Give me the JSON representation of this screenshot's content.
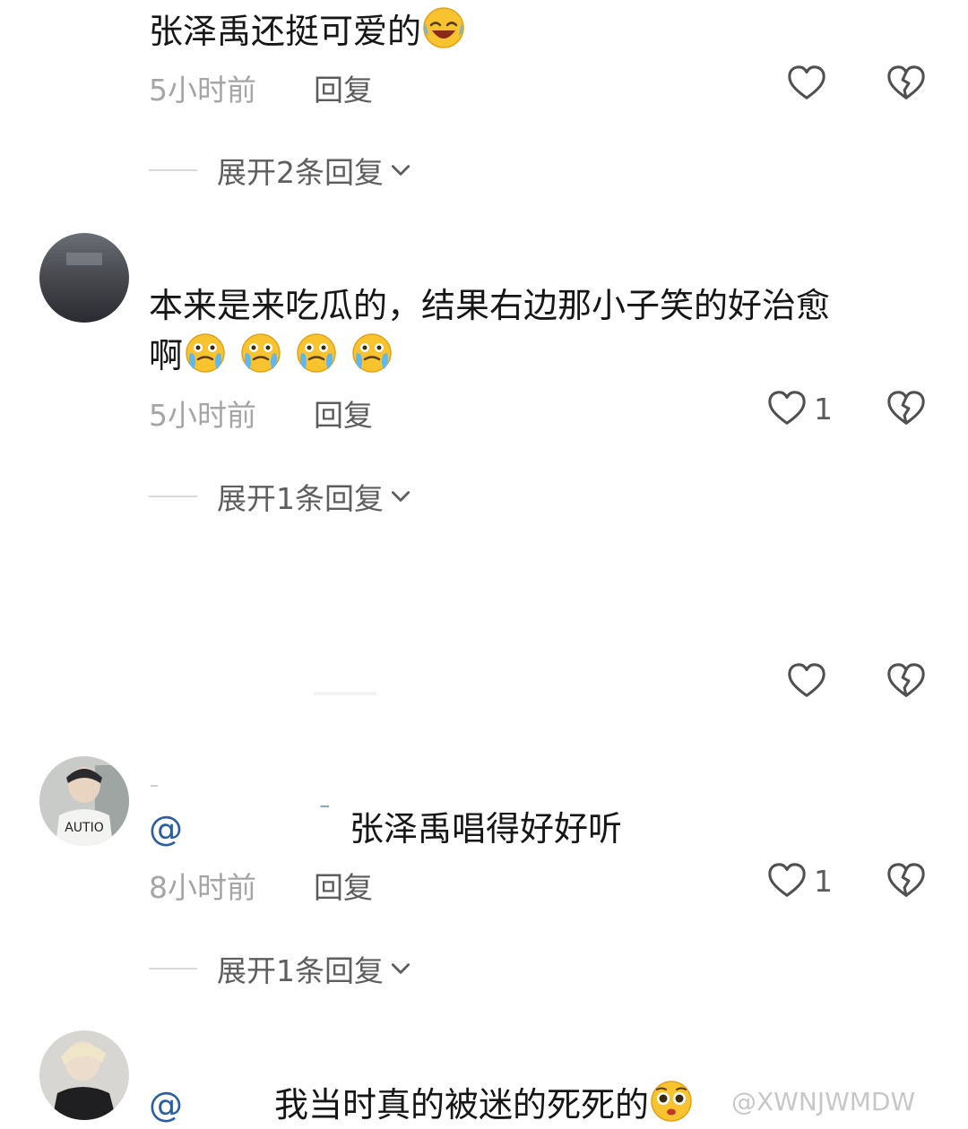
{
  "comments": [
    {
      "text": "张泽禹还挺可爱的",
      "time": "5小时前",
      "reply_label": "回复",
      "like_count": "",
      "expand_label": "展开2条回复"
    },
    {
      "text_line1": "本来是来吃瓜的，结果右边那小子笑的好治愈",
      "text_line2": "啊",
      "time": "5小时前",
      "reply_label": "回复",
      "like_count": "1",
      "expand_label": "展开1条回复"
    },
    {
      "mention": "@",
      "mention_tail": "⁻",
      "text": "张泽禹唱得好好听",
      "time": "8小时前",
      "reply_label": "回复",
      "like_count": "1",
      "expand_label": "展开1条回复"
    },
    {
      "mention": "@",
      "text": "我当时真的被迷的死死的"
    }
  ],
  "watermark": "@XWNJWMDW",
  "icons": {
    "like": "heart-outline-icon",
    "dislike": "broken-heart-icon",
    "expand": "chevron-down-icon"
  },
  "colors": {
    "mention": "#2b5fa3",
    "meta": "#a5a5a5"
  }
}
